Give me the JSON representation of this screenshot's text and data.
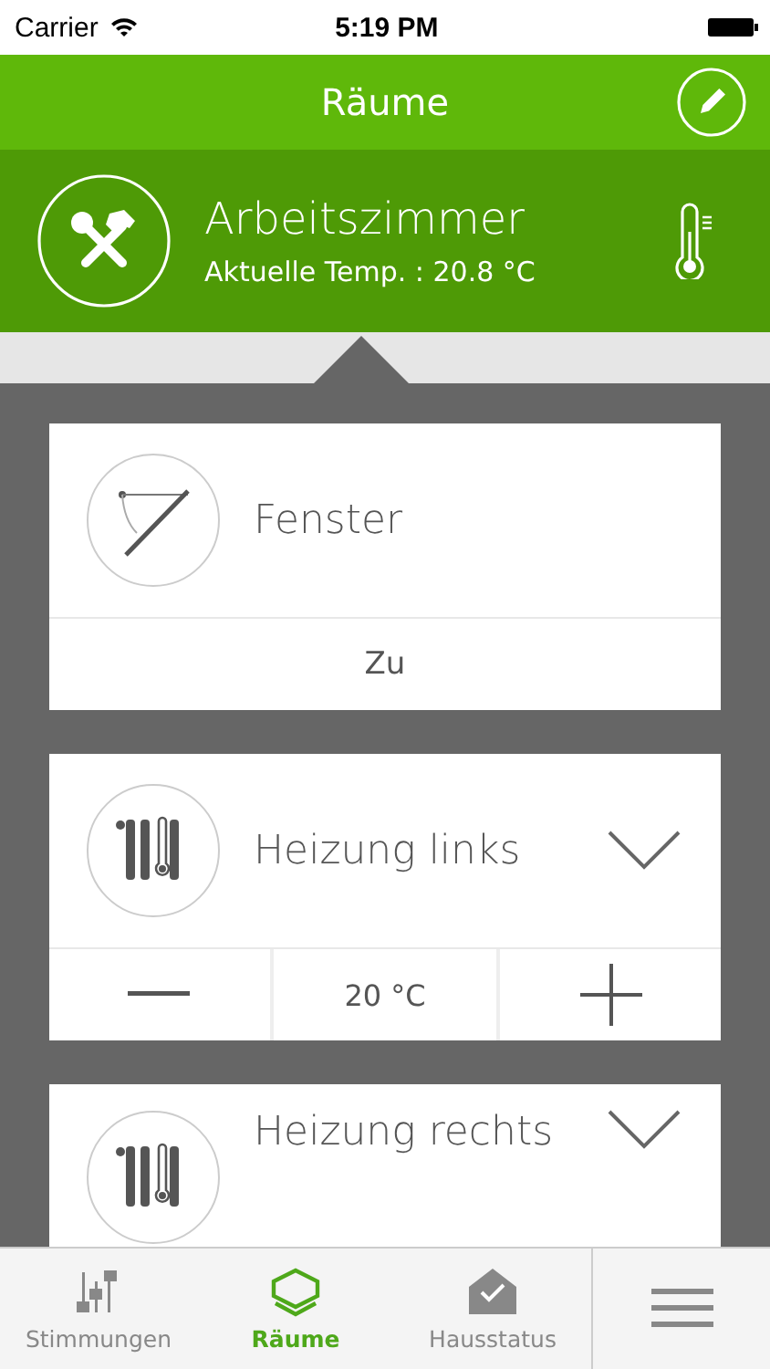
{
  "status_bar": {
    "carrier": "Carrier",
    "time": "5:19 PM"
  },
  "header": {
    "title": "Räume"
  },
  "room": {
    "name": "Arbeitszimmer",
    "temperature": "Aktuelle Temp. : 20.8 °C"
  },
  "devices": [
    {
      "kind": "window",
      "name": "Fenster",
      "state": "Zu"
    },
    {
      "kind": "heater",
      "name": "Heizung links",
      "setpoint": "20 °C"
    },
    {
      "kind": "heater",
      "name": "Heizung rechts"
    }
  ],
  "tabs": [
    {
      "kind": "scenes",
      "label": "Stimmungen",
      "selected": false
    },
    {
      "kind": "rooms",
      "label": "Räume",
      "selected": true
    },
    {
      "kind": "house",
      "label": "Hausstatus",
      "selected": false
    }
  ]
}
